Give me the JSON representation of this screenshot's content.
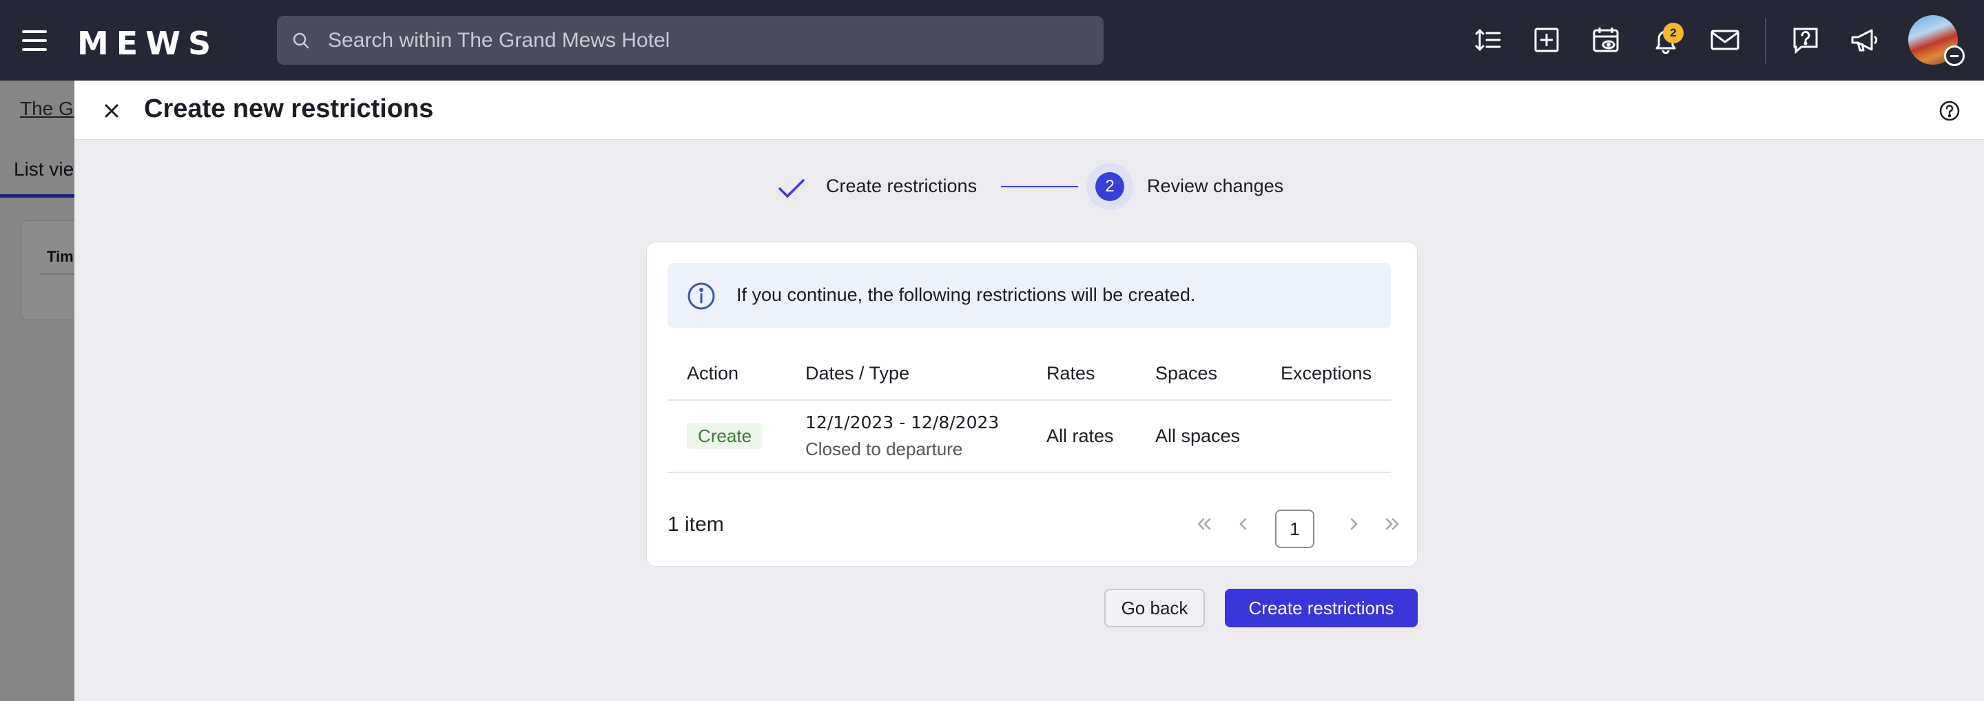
{
  "topbar": {
    "logo": "MEWS",
    "search_placeholder": "Search within The Grand Mews Hotel",
    "notifications_count": "2",
    "icons": [
      "menu-icon",
      "sort-icon",
      "add-box-icon",
      "calendar-view-icon",
      "bell-icon",
      "mail-icon",
      "help-chat-icon",
      "megaphone-icon",
      "avatar"
    ]
  },
  "background": {
    "breadcrumb": "The Gr",
    "tab": "List vie",
    "card_header": "Tim"
  },
  "drawer": {
    "title": "Create new restrictions",
    "stepper": {
      "step1_label": "Create restrictions",
      "step2_number": "2",
      "step2_label": "Review changes"
    },
    "info_message": "If you continue, the following restrictions will be created.",
    "table": {
      "headers": [
        "Action",
        "Dates / Type",
        "Rates",
        "Spaces",
        "Exceptions"
      ],
      "rows": [
        {
          "action": "Create",
          "dates": "12/1/2023 - 12/8/2023",
          "type": "Closed to departure",
          "rates": "All rates",
          "spaces": "All spaces",
          "exceptions": ""
        }
      ]
    },
    "pagination": {
      "item_count": "1 item",
      "current_page": "1"
    },
    "buttons": {
      "back": "Go back",
      "create": "Create restrictions"
    }
  },
  "colors": {
    "topbar_bg": "#252735",
    "accent": "#3a35d8",
    "badge": "#f5b731",
    "create_pill_bg": "#edf7ec",
    "create_pill_text": "#3e7d33",
    "info_bg": "#edf1fa"
  }
}
